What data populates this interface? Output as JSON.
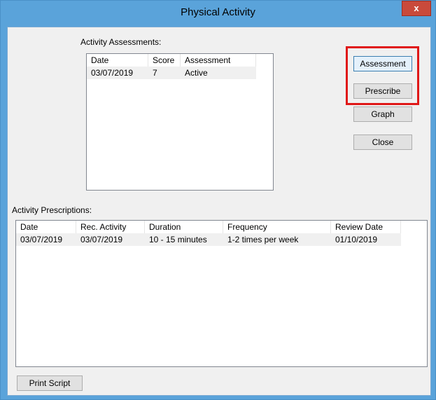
{
  "window": {
    "title": "Physical Activity",
    "close_glyph": "x"
  },
  "assessments": {
    "label": "Activity Assessments:",
    "columns": [
      "Date",
      "Score",
      "Assessment"
    ],
    "rows": [
      [
        "03/07/2019",
        "7",
        "Active"
      ]
    ]
  },
  "prescriptions": {
    "label": "Activity Prescriptions:",
    "columns": [
      "Date",
      "Rec. Activity",
      "Duration",
      "Frequency",
      "Review Date"
    ],
    "rows": [
      [
        "03/07/2019",
        "03/07/2019",
        "10 - 15 minutes",
        "1-2 times per week",
        "01/10/2019"
      ]
    ]
  },
  "buttons": {
    "assessment": "Assessment",
    "prescribe": "Prescribe",
    "graph": "Graph",
    "close": "Close",
    "print_script": "Print Script"
  },
  "colors": {
    "titlebar": "#5aa3da",
    "highlight": "#e01818"
  }
}
